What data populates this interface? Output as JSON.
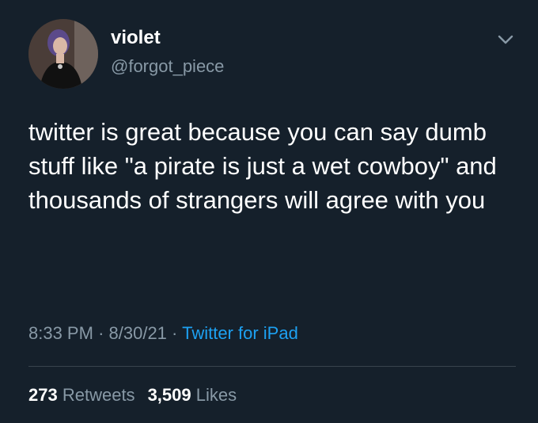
{
  "user": {
    "display_name": "violet",
    "handle": "@forgot_piece"
  },
  "tweet": {
    "text": "twitter is great because you can say dumb stuff like \"a pirate is just a wet cowboy\" and thousands of strangers will agree with you",
    "time": "8:33 PM",
    "date": "8/30/21",
    "source": "Twitter for iPad",
    "separator": "·"
  },
  "stats": {
    "retweets_count": "273",
    "retweets_label": "Retweets",
    "likes_count": "3,509",
    "likes_label": "Likes"
  },
  "icons": {
    "menu": "chevron-down-icon"
  },
  "colors": {
    "background": "#15202b",
    "primary_text": "#ffffff",
    "secondary_text": "#8899a6",
    "link": "#1da1f2",
    "divider": "#38444d"
  }
}
